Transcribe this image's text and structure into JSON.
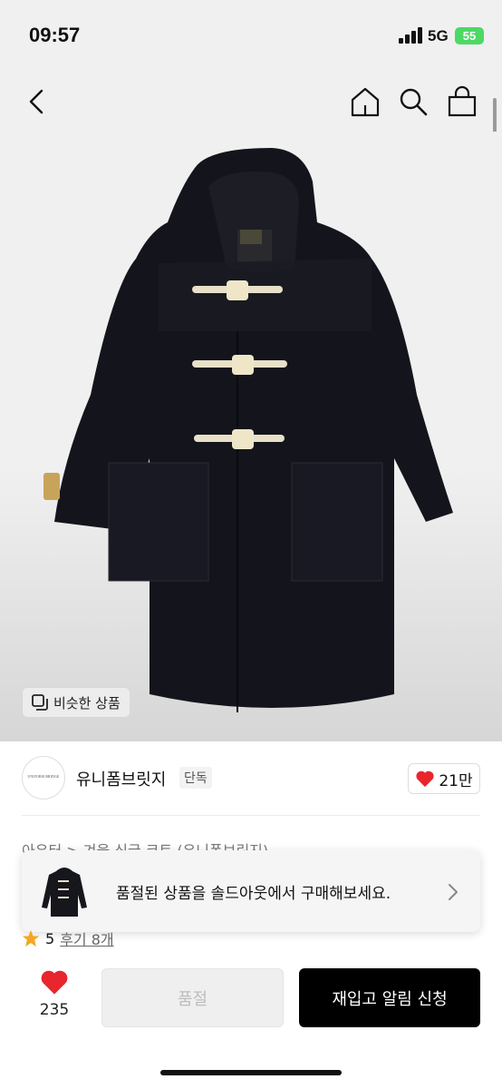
{
  "status_bar": {
    "time": "09:57",
    "network": "5G",
    "battery": "55"
  },
  "nav": {
    "back_icon": "chevron-left-icon",
    "home_icon": "home-icon",
    "search_icon": "search-icon",
    "bag_icon": "shopping-bag-icon"
  },
  "hero": {
    "similar_label": "비슷한 상품",
    "similar_icon": "copy-squares-icon"
  },
  "store": {
    "logo_text": "UNIFORM BRIDGE",
    "name": "유니폼브릿지",
    "badge": "단독",
    "likes": "21만"
  },
  "breadcrumb": "아우터 > 겨울 싱글 코트 (유니폼브릿지)",
  "toast": {
    "message": "품절된 상품을 솔드아웃에서 구매해보세요."
  },
  "rating": {
    "score": "5",
    "reviews": "후기 8개"
  },
  "bottom_bar": {
    "wish_count": "235",
    "soldout_label": "품절",
    "restock_label": "재입고 알림 신청"
  },
  "colors": {
    "heart": "#e8262c",
    "star": "#f5a623",
    "primary_button": "#000000",
    "battery": "#4cd964"
  }
}
